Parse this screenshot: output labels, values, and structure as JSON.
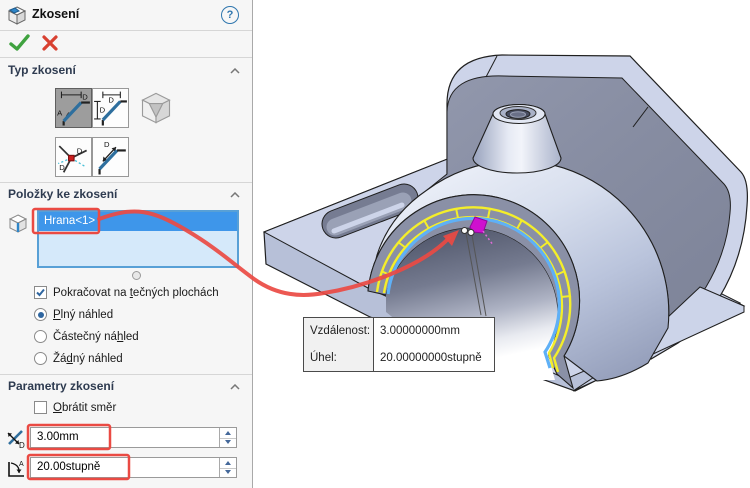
{
  "panel": {
    "title": "Zkosení",
    "help_glyph": "?",
    "typ_header": "Typ zkosení",
    "type_buttons": [
      "angle-distance",
      "distance-distance",
      "face-face",
      "vertex",
      "offset-face"
    ],
    "type_selected": "angle-distance",
    "polozky_header": "Položky ke zkosení",
    "selection_item": "Hrana<1>",
    "tangent": {
      "pre": "Pokračovat na ",
      "u": "t",
      "post": "ečných plochách",
      "checked": true
    },
    "radios": [
      {
        "pre": "",
        "u": "P",
        "post": "lný náhled",
        "selected": true
      },
      {
        "pre": "Částečný ná",
        "u": "h",
        "post": "led",
        "selected": false
      },
      {
        "pre": "Žá",
        "u": "d",
        "post": "ný náhled",
        "selected": false
      }
    ],
    "parametry_header": "Parametry zkosení",
    "reverse": {
      "pre": "",
      "u": "O",
      "post": "brátit směr",
      "checked": false
    },
    "distance_value": "3.00mm",
    "angle_value": "20.00stupně"
  },
  "callout": {
    "rows": [
      {
        "label": "Vzdálenost:",
        "value": "3.00000000mm"
      },
      {
        "label": "Úhel:",
        "value": "20.00000000stupně"
      }
    ]
  },
  "colors": {
    "selection_blue": "#3e96ea",
    "annotation_red": "#ea4a43",
    "preview_yellow": "#f4ee2a",
    "edge_blue": "#5fb0f6",
    "marker_magenta": "#cf10cf",
    "ok_green": "#3fa23f",
    "cancel_red": "#d84030"
  }
}
